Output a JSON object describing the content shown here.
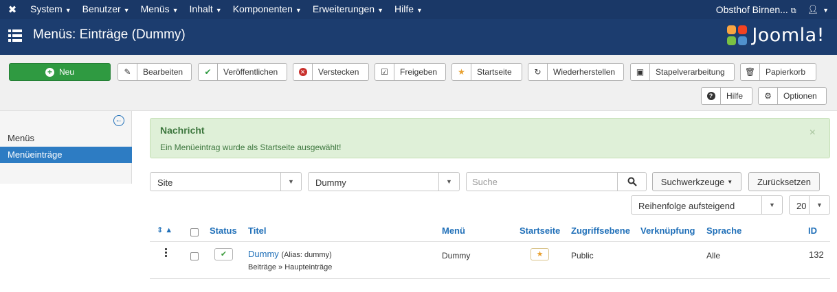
{
  "topnav": {
    "items": [
      {
        "label": "System"
      },
      {
        "label": "Benutzer"
      },
      {
        "label": "Menüs"
      },
      {
        "label": "Inhalt"
      },
      {
        "label": "Komponenten"
      },
      {
        "label": "Erweiterungen"
      },
      {
        "label": "Hilfe"
      }
    ],
    "site_link": "Obsthof Birnen...",
    "colors": {
      "bar": "#1a3867"
    }
  },
  "header": {
    "title": "Menüs: Einträge (Dummy)",
    "brand": "Joomla!"
  },
  "toolbar": {
    "new": "Neu",
    "edit": "Bearbeiten",
    "publish": "Veröffentlichen",
    "unpublish": "Verstecken",
    "checkin": "Freigeben",
    "home": "Startseite",
    "rebuild": "Wiederherstellen",
    "batch": "Stapelverarbeitung",
    "trash": "Papierkorb",
    "help": "Hilfe",
    "options": "Optionen"
  },
  "sidebar": {
    "items": [
      {
        "label": "Menüs",
        "active": false
      },
      {
        "label": "Menüeinträge",
        "active": true
      }
    ]
  },
  "message": {
    "heading": "Nachricht",
    "text": "Ein Menüeintrag wurde als Startseite ausgewählt!",
    "close": "×"
  },
  "filters": {
    "client": "Site",
    "menu": "Dummy",
    "search_placeholder": "Suche",
    "search_tools": "Suchwerkzeuge",
    "reset": "Zurücksetzen",
    "ordering": "Reihenfolge aufsteigend",
    "limit": "20"
  },
  "table": {
    "headers": {
      "status": "Status",
      "title": "Titel",
      "menu": "Menü",
      "home": "Startseite",
      "access": "Zugriffsebene",
      "link": "Verknüpfung",
      "language": "Sprache",
      "id": "ID"
    },
    "rows": [
      {
        "title": "Dummy",
        "alias": "(Alias: dummy)",
        "path": "Beiträge » Haupteinträge",
        "menu": "Dummy",
        "access": "Public",
        "language": "Alle",
        "id": "132"
      }
    ]
  }
}
